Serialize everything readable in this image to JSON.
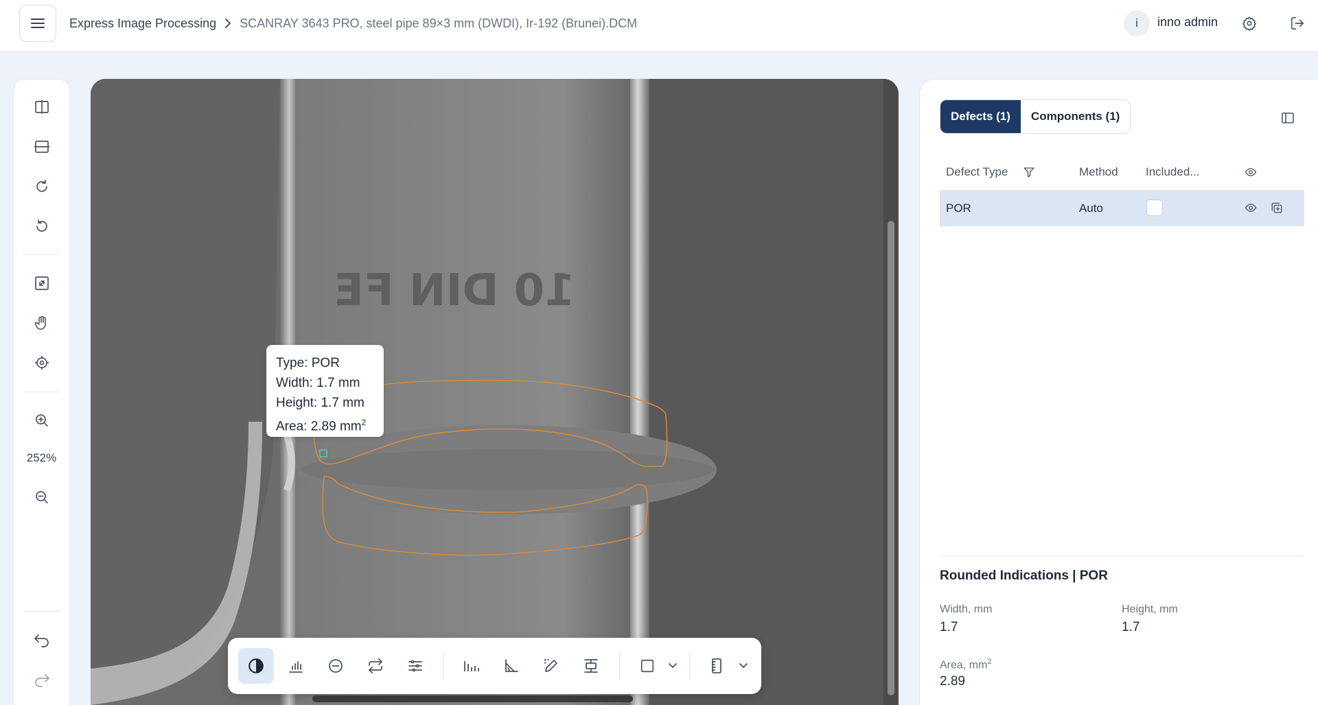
{
  "header": {
    "breadcrumb_root": "Express Image Processing",
    "breadcrumb_current": "SCANRAY 3643 PRO, steel pipe 89×3 mm (DWDI), Ir-192 (Brunei).DCM",
    "user_initial": "i",
    "user_name": "inno admin"
  },
  "left_toolbar": {
    "zoom_level": "252%"
  },
  "viewer": {
    "image_text": "10 DIN FE",
    "tooltip": {
      "type": "Type: POR",
      "width": "Width: 1.7 mm",
      "height": "Height: 1.7 mm",
      "area": "Area: 2.89 mm",
      "area_exp": "2"
    }
  },
  "panel": {
    "tabs": [
      {
        "label": "Defects (1)",
        "active": true
      },
      {
        "label": "Components (1)",
        "active": false
      }
    ],
    "table": {
      "columns": [
        "Defect Type",
        "Method",
        "Included..."
      ],
      "rows": [
        {
          "type": "POR",
          "method": "Auto",
          "included": false
        }
      ]
    },
    "details": {
      "title": "Rounded Indications | POR",
      "width_label": "Width, mm",
      "width_value": "1.7",
      "height_label": "Height, mm",
      "height_value": "1.7",
      "area_label": "Area, mm",
      "area_exp": "2",
      "area_value": "2.89"
    }
  },
  "colors": {
    "accent": "#1e3a64",
    "selected_row": "#dbe6f4",
    "defect_outline": "#d98a3a",
    "defect_marker": "#5fc3b0"
  }
}
